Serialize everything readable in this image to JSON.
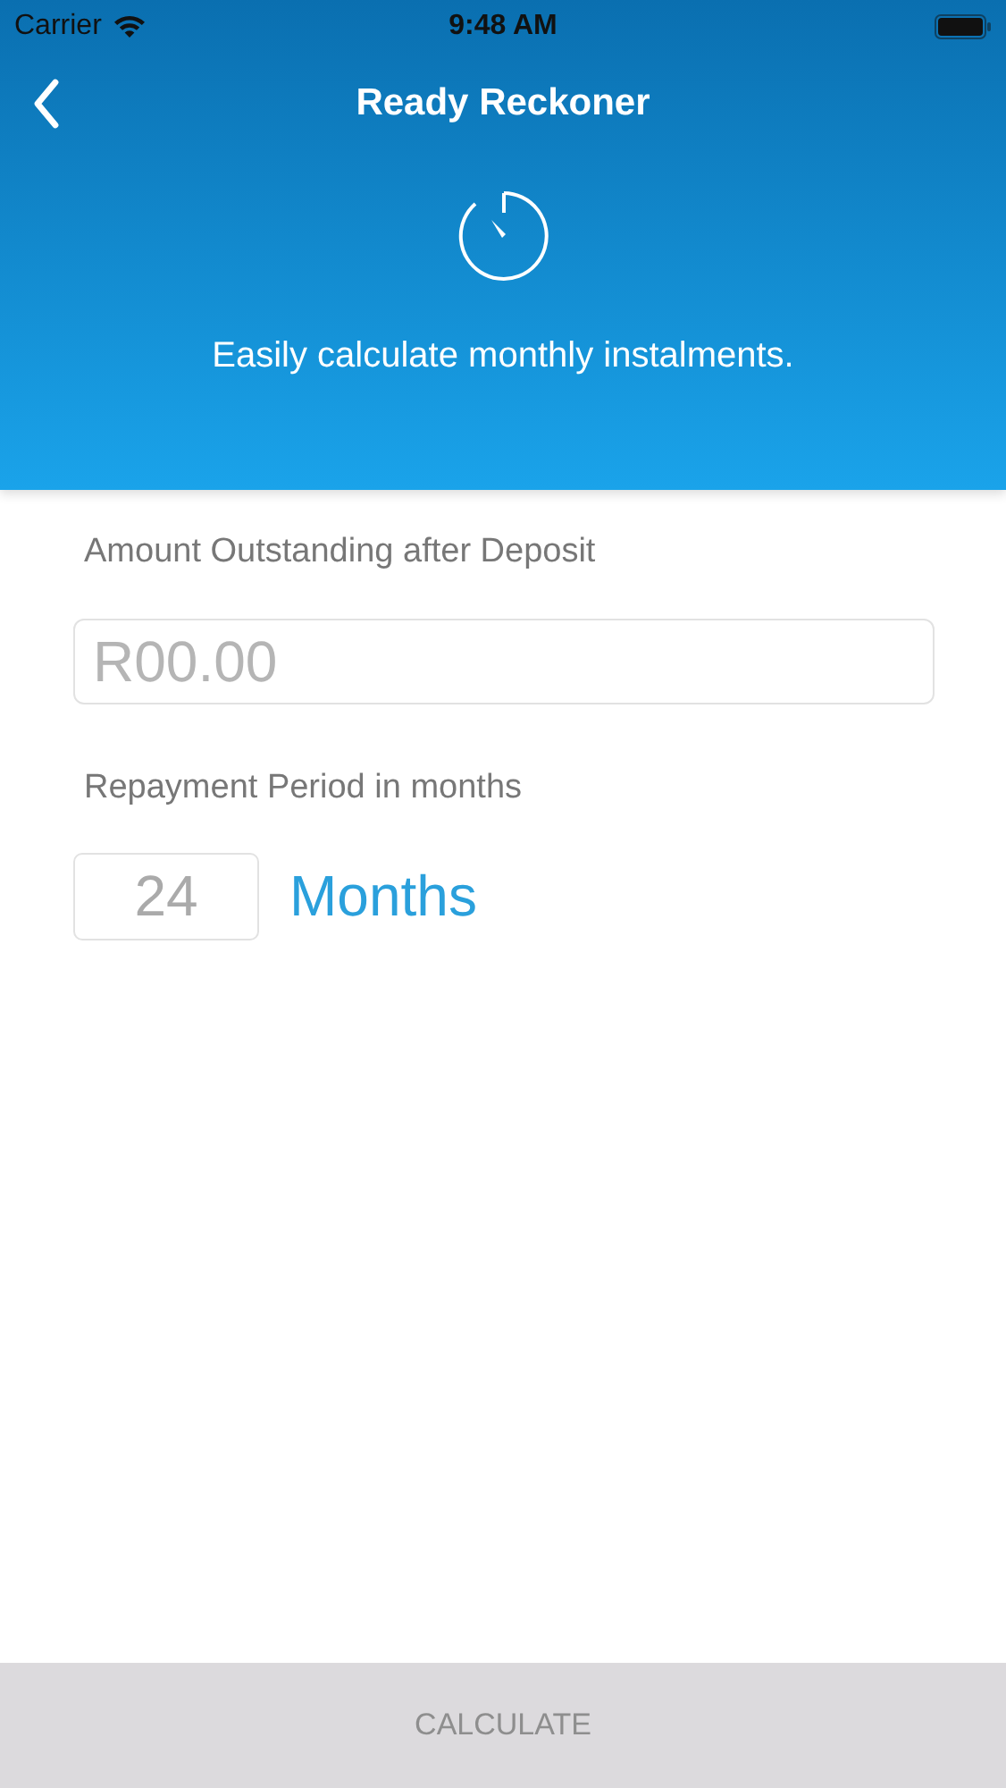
{
  "status_bar": {
    "carrier": "Carrier",
    "time": "9:48 AM"
  },
  "nav": {
    "title": "Ready Reckoner"
  },
  "header": {
    "subtitle": "Easily calculate monthly instalments."
  },
  "form": {
    "amount_label": "Amount Outstanding after Deposit",
    "amount_placeholder": "R00.00",
    "period_label": "Repayment Period in months",
    "period_value": "24",
    "period_unit": "Months"
  },
  "calculate_button": {
    "label": "CALCULATE",
    "disabled": true
  }
}
